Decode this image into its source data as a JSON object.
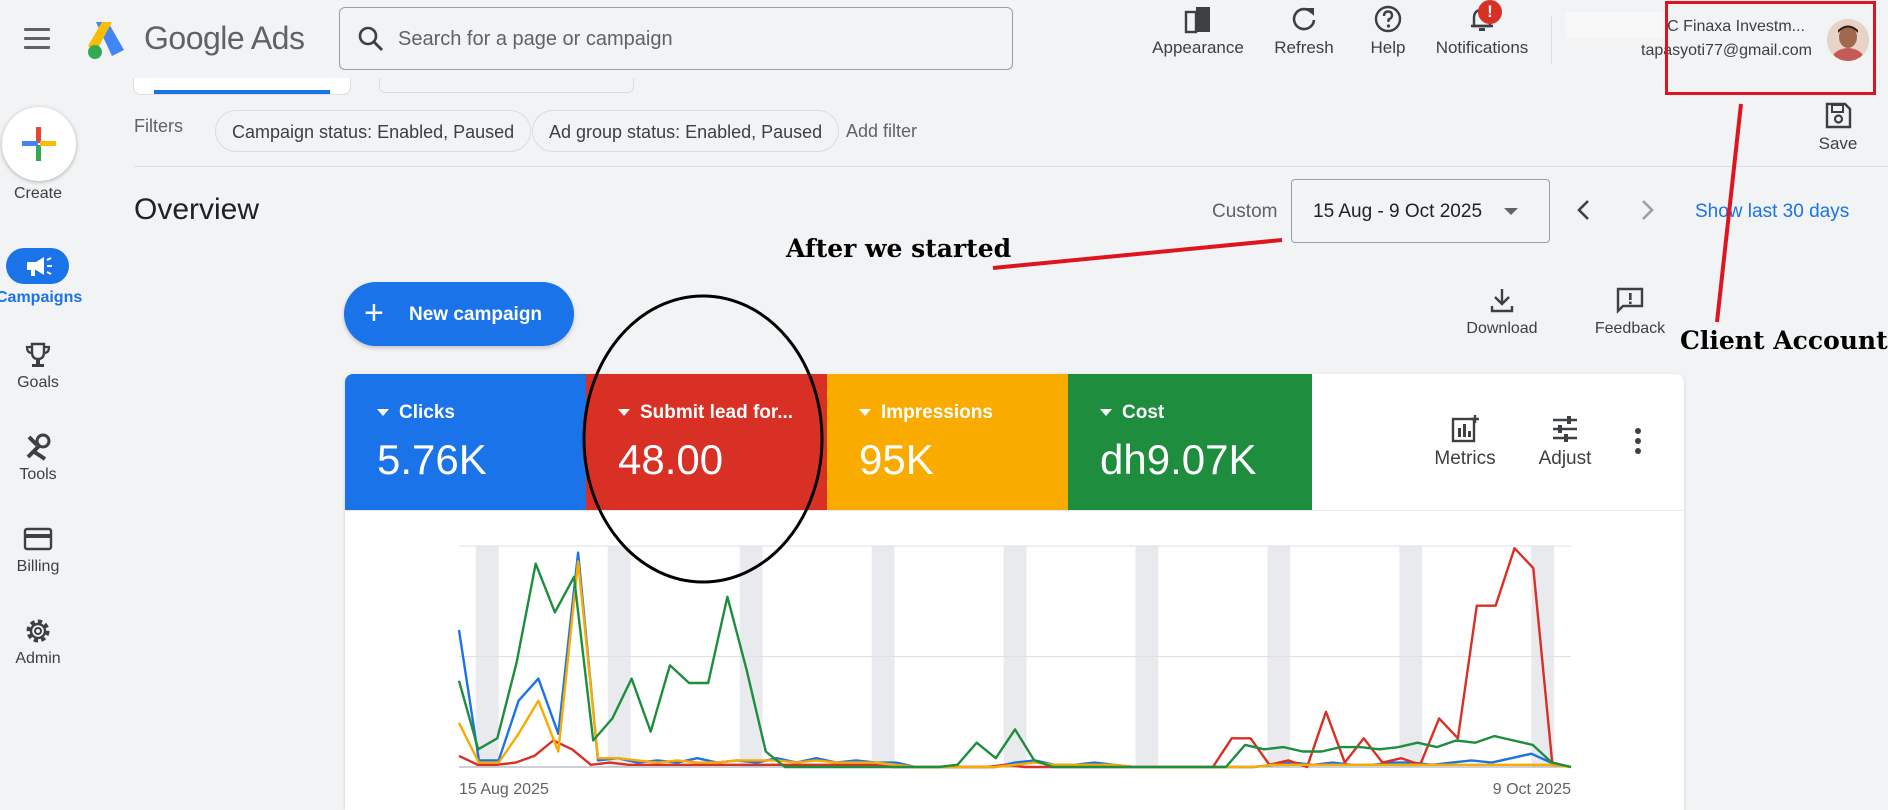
{
  "header": {
    "brand_google": "Google",
    "brand_ads": "Ads",
    "search_placeholder": "Search for a page or campaign",
    "tools": {
      "appearance": "Appearance",
      "refresh": "Refresh",
      "help": "Help",
      "notifications": "Notifications"
    },
    "notification_count": "!",
    "account_name": "C Finaxa Investm...",
    "account_email": "tapasyoti77@gmail.com"
  },
  "rail": {
    "create": "Create",
    "campaigns": "Campaigns",
    "goals": "Goals",
    "tools": "Tools",
    "billing": "Billing",
    "admin": "Admin"
  },
  "filters": {
    "label": "Filters",
    "chips": [
      "Campaign status: Enabled, Paused",
      "Ad group status: Enabled, Paused"
    ],
    "add_filter": "Add filter",
    "save": "Save"
  },
  "overview": {
    "title": "Overview",
    "custom_label": "Custom",
    "date_range": "15 Aug - 9 Oct 2025",
    "show_last": "Show last 30 days",
    "new_campaign": "New campaign",
    "download": "Download",
    "feedback": "Feedback"
  },
  "annotations": {
    "after_started": "After we started",
    "client_account": "Client Account"
  },
  "metrics": [
    {
      "label": "Clicks",
      "value": "5.76K",
      "color": "#1a73e8"
    },
    {
      "label": "Submit lead for...",
      "value": "48.00",
      "color": "#d93025"
    },
    {
      "label": "Impressions",
      "value": "95K",
      "color": "#f9ab00"
    },
    {
      "label": "Cost",
      "value": "dh9.07K",
      "color": "#1e8e3e"
    }
  ],
  "card_tools": {
    "metrics": "Metrics",
    "adjust": "Adjust"
  },
  "chart_data": {
    "type": "line",
    "x_start_label": "15 Aug 2025",
    "x_end_label": "9 Oct 2025",
    "ylim": [
      0,
      1
    ],
    "grid": true,
    "weekend_bands": true,
    "series": [
      {
        "name": "Clicks",
        "color": "#1a73e8",
        "values": [
          0.62,
          0.03,
          0.03,
          0.3,
          0.4,
          0.15,
          0.97,
          0.03,
          0.04,
          0.02,
          0.03,
          0.02,
          0.04,
          0.02,
          0.03,
          0.02,
          0.04,
          0.02,
          0.04,
          0.02,
          0.03,
          0.02,
          0.02,
          0.0,
          0.0,
          0.0,
          0.0,
          0.0,
          0.02,
          0.03,
          0.01,
          0.01,
          0.02,
          0.01,
          0.0,
          0.0,
          0.0,
          0.0,
          0.0,
          0.0,
          0.0,
          0.01,
          0.02,
          0.01,
          0.02,
          0.01,
          0.01,
          0.02,
          0.02,
          0.01,
          0.02,
          0.03,
          0.02,
          0.04,
          0.06,
          0.02,
          0.0
        ]
      },
      {
        "name": "Submit lead for...",
        "color": "#d93025",
        "values": [
          0.05,
          0.01,
          0.01,
          0.02,
          0.05,
          0.12,
          0.08,
          0.01,
          0.02,
          0.01,
          0.01,
          0.01,
          0.01,
          0.01,
          0.01,
          0.01,
          0.01,
          0.01,
          0.01,
          0.01,
          0.01,
          0.01,
          0.01,
          0.0,
          0.0,
          0.0,
          0.0,
          0.0,
          0.0,
          0.01,
          0.0,
          0.0,
          0.0,
          0.0,
          0.0,
          0.0,
          0.0,
          0.0,
          0.0,
          0.0,
          0.0,
          0.13,
          0.13,
          0.01,
          0.03,
          0.0,
          0.25,
          0.02,
          0.13,
          0.02,
          0.04,
          0.01,
          0.22,
          0.13,
          0.73,
          0.73,
          0.99,
          0.9,
          0.02,
          0.0
        ]
      },
      {
        "name": "Impressions",
        "color": "#f9ab00",
        "values": [
          0.2,
          0.02,
          0.02,
          0.15,
          0.3,
          0.07,
          0.93,
          0.04,
          0.04,
          0.03,
          0.02,
          0.03,
          0.02,
          0.02,
          0.03,
          0.03,
          0.03,
          0.02,
          0.03,
          0.02,
          0.02,
          0.02,
          0.01,
          0.0,
          0.0,
          0.0,
          0.0,
          0.0,
          0.01,
          0.02,
          0.01,
          0.01,
          0.01,
          0.01,
          0.0,
          0.0,
          0.0,
          0.0,
          0.0,
          0.0,
          0.0,
          0.01,
          0.01,
          0.01,
          0.01,
          0.01,
          0.01,
          0.01,
          0.01,
          0.01,
          0.01,
          0.01,
          0.01,
          0.01,
          0.01,
          0.01,
          0.0
        ]
      },
      {
        "name": "Cost",
        "color": "#1e8e3e",
        "values": [
          0.39,
          0.08,
          0.13,
          0.47,
          0.92,
          0.7,
          0.86,
          0.12,
          0.22,
          0.4,
          0.16,
          0.46,
          0.38,
          0.38,
          0.77,
          0.44,
          0.07,
          0.0,
          0.0,
          0.0,
          0.0,
          0.0,
          0.0,
          0.0,
          0.0,
          0.0,
          0.01,
          0.11,
          0.04,
          0.17,
          0.03,
          0.0,
          0.0,
          0.0,
          0.0,
          0.0,
          0.0,
          0.0,
          0.0,
          0.0,
          0.0,
          0.1,
          0.08,
          0.09,
          0.07,
          0.07,
          0.09,
          0.09,
          0.08,
          0.09,
          0.11,
          0.09,
          0.12,
          0.11,
          0.14,
          0.12,
          0.1,
          0.02,
          0.0
        ]
      }
    ]
  }
}
